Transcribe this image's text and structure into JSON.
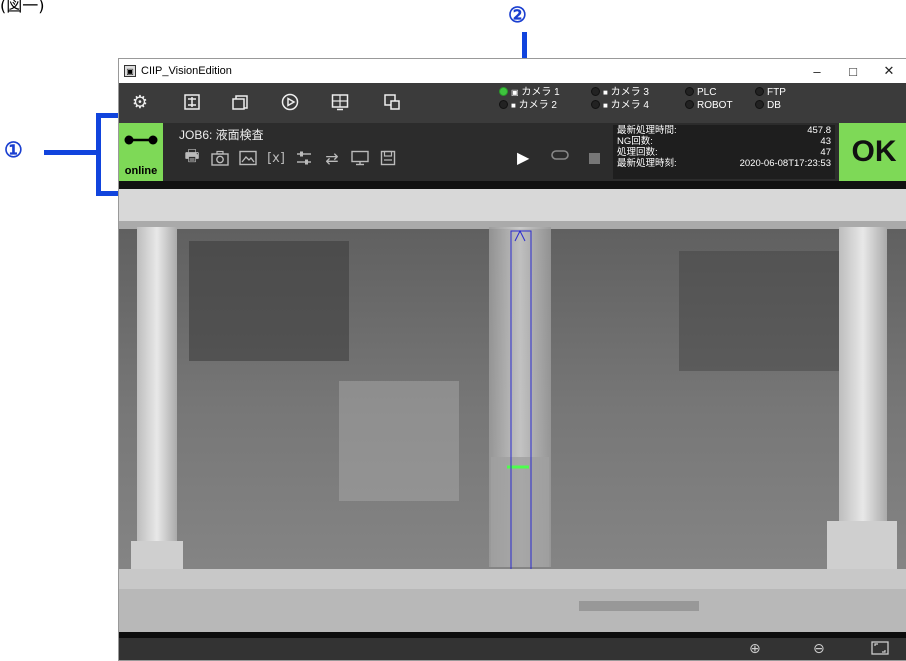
{
  "page": {
    "top_text": "(図一)"
  },
  "callouts": [
    {
      "num": "①"
    },
    {
      "num": "②"
    }
  ],
  "window": {
    "title": "CIIP_VisionEdition",
    "controls": {
      "minimize": "–",
      "maximize": "□",
      "close": "✕"
    }
  },
  "toolbar": {
    "icons": [
      "gear-icon",
      "adjust-icon",
      "image-stack-icon",
      "play-circle-icon",
      "monitor-grid-icon",
      "layers-icon"
    ]
  },
  "status": {
    "cameras": [
      {
        "label": "カメラ 1",
        "state": "ok"
      },
      {
        "label": "カメラ 2",
        "state": "off"
      },
      {
        "label": "カメラ 3",
        "state": "off"
      },
      {
        "label": "カメラ 4",
        "state": "off"
      }
    ],
    "devices": [
      {
        "label": "PLC",
        "state": "off"
      },
      {
        "label": "ROBOT",
        "state": "off"
      },
      {
        "label": "FTP",
        "state": "off"
      },
      {
        "label": "DB",
        "state": "off"
      }
    ],
    "colors": {
      "ok": "#3ec43e",
      "off": "#222222"
    }
  },
  "infobar": {
    "online_label": "online",
    "job_title": "JOB6: 液面検査",
    "stats": [
      {
        "label": "最新処理時間:",
        "value": "457.8"
      },
      {
        "label": "NG回数:",
        "value": "43"
      },
      {
        "label": "処理回数:",
        "value": "47"
      },
      {
        "label": "最新処理時刻:",
        "value": "2020-06-08T17:23:53"
      }
    ],
    "result": "OK",
    "result_color": "#7ed957"
  },
  "bottombar": {
    "icons": [
      "zoom-in-icon",
      "zoom-out-icon",
      "fit-screen-icon"
    ]
  }
}
